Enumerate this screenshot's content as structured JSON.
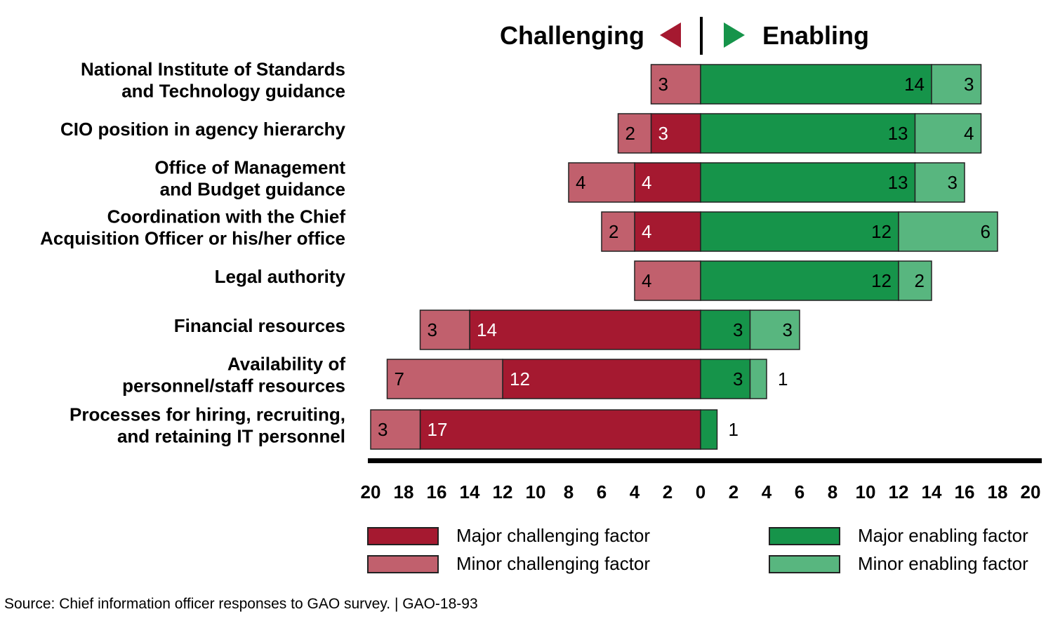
{
  "chart_data": {
    "type": "bar",
    "subtype": "diverging-stacked-horizontal",
    "title": "",
    "header": {
      "left": "Challenging",
      "right": "Enabling"
    },
    "categories": [
      [
        "National Institute of Standards",
        "and Technology guidance"
      ],
      [
        "CIO position in agency hierarchy"
      ],
      [
        "Office of Management",
        "and Budget guidance"
      ],
      [
        "Coordination with the Chief",
        "Acquisition Officer or his/her office"
      ],
      [
        "Legal authority"
      ],
      [
        "Financial resources"
      ],
      [
        "Availability of",
        "personnel/staff resources"
      ],
      [
        "Processes for hiring, recruiting,",
        "and retaining IT personnel"
      ]
    ],
    "series": [
      {
        "name": "Major challenging factor",
        "side": "left",
        "color": "#A51930",
        "label_color": "#ffffff",
        "values": [
          0,
          3,
          4,
          4,
          0,
          14,
          12,
          17
        ]
      },
      {
        "name": "Minor challenging factor",
        "side": "left",
        "color": "#C1606D",
        "label_color": "#000000",
        "values": [
          3,
          2,
          4,
          2,
          4,
          3,
          7,
          3
        ]
      },
      {
        "name": "Major enabling factor",
        "side": "right",
        "color": "#16944A",
        "label_color": "#000000",
        "values": [
          14,
          13,
          13,
          12,
          12,
          3,
          3,
          1
        ]
      },
      {
        "name": "Minor enabling factor",
        "side": "right",
        "color": "#58B67F",
        "label_color": "#000000",
        "values": [
          3,
          4,
          3,
          6,
          2,
          3,
          1,
          0
        ]
      }
    ],
    "xlim": [
      -20,
      20
    ],
    "xticks": [
      "20",
      "18",
      "16",
      "14",
      "12",
      "10",
      "8",
      "6",
      "4",
      "2",
      "0",
      "2",
      "4",
      "6",
      "8",
      "10",
      "12",
      "14",
      "16",
      "18",
      "20"
    ],
    "xlabel": "",
    "ylabel": "",
    "grid": false,
    "legend": {
      "placement": "bottom",
      "order": [
        "Major challenging factor",
        "Minor challenging factor",
        "Major enabling factor",
        "Minor enabling factor"
      ]
    },
    "source": "Source: Chief information officer responses to GAO survey.  |  GAO-18-93"
  },
  "colors": {
    "challenging_marker": "#A51930",
    "enabling_marker": "#16944A"
  }
}
